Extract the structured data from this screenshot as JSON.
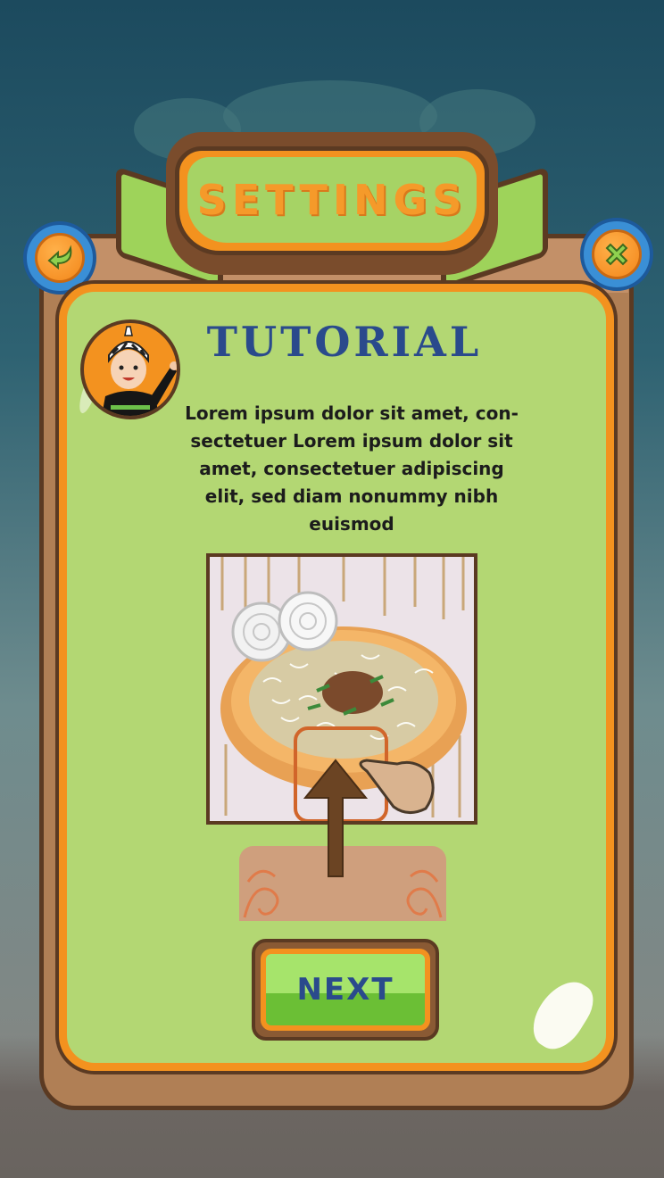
{
  "header": {
    "title": "SETTINGS"
  },
  "buttons": {
    "back_icon": "back-arrow-icon",
    "close_icon": "close-x-icon",
    "next_label": "NEXT"
  },
  "tutorial": {
    "title": "TUTORIAL",
    "text": "Lorem ipsum dolor sit amet, con-sectetuer Lorem ipsum dolor sit amet, consectetuer adipiscing elit, sed diam nonummy nibh euismod",
    "illustration": "food-plate-swipe-up-illustration"
  },
  "colors": {
    "panel": "#b3d773",
    "panel_border": "#f3921f",
    "frame": "#b07f55",
    "title_blue": "#2a4a8c",
    "accent_orange": "#f3921f",
    "button_blue": "#3a8fd6"
  }
}
